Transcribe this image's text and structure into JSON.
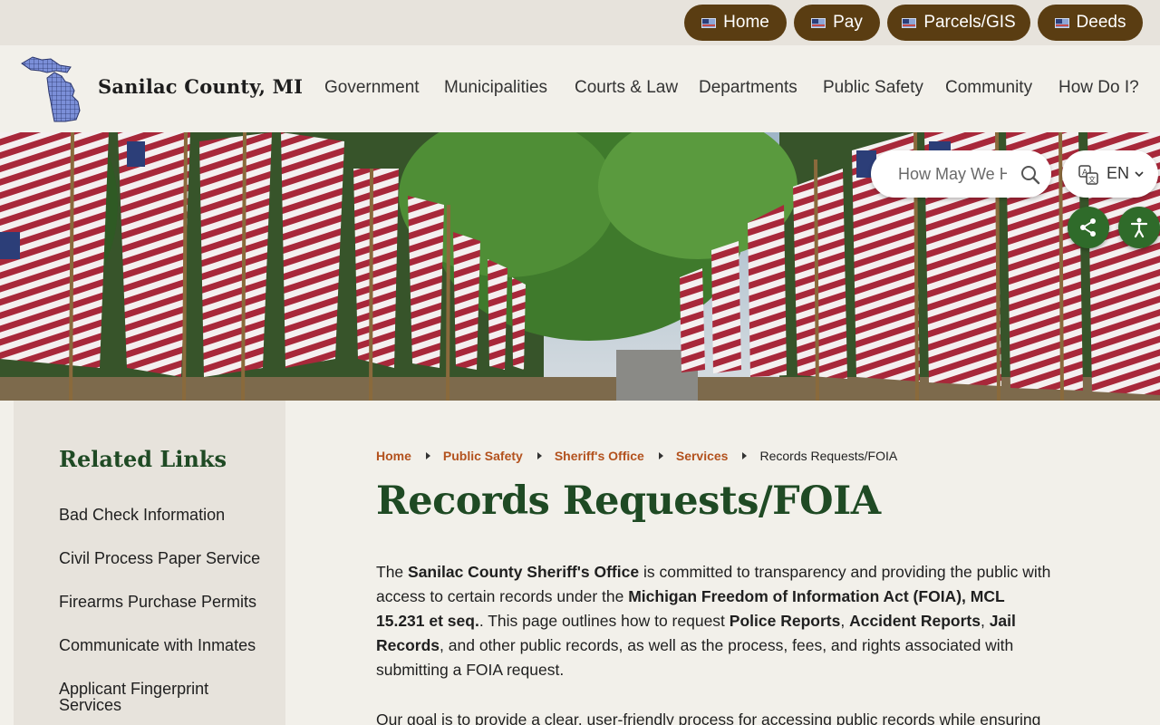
{
  "utility_nav": [
    {
      "label": "Home"
    },
    {
      "label": "Pay"
    },
    {
      "label": "Parcels/GIS"
    },
    {
      "label": "Deeds"
    }
  ],
  "site": {
    "name": "Sanilac County, MI"
  },
  "main_nav": [
    {
      "label": "Government"
    },
    {
      "label": "Municipalities"
    },
    {
      "label": "Courts & Law"
    },
    {
      "label": "Departments"
    },
    {
      "label": "Public Safety"
    },
    {
      "label": "Community"
    },
    {
      "label": "How Do I?"
    }
  ],
  "search": {
    "placeholder": "How May We Help You?"
  },
  "language": {
    "code": "EN"
  },
  "sidebar": {
    "title": "Related Links",
    "links": [
      {
        "label": "Bad Check Information"
      },
      {
        "label": "Civil Process Paper Service"
      },
      {
        "label": "Firearms Purchase Permits"
      },
      {
        "label": "Communicate with Inmates"
      },
      {
        "label": "Applicant Fingerprint Services"
      }
    ]
  },
  "breadcrumb": {
    "items": [
      {
        "label": "Home"
      },
      {
        "label": "Public Safety"
      },
      {
        "label": "Sheriff's Office"
      },
      {
        "label": "Services"
      }
    ],
    "current": "Records Requests/FOIA"
  },
  "page": {
    "title": "Records Requests/FOIA",
    "intro": {
      "t1": "The ",
      "b1": "Sanilac County Sheriff's Office",
      "t2": " is committed to transparency and providing the public with access to certain records under the ",
      "b2": "Michigan Freedom of Information Act (FOIA), MCL 15.231 et seq.",
      "t3": ". This page outlines how to request ",
      "b3": "Police Reports",
      "t4": ", ",
      "b4": "Accident Reports",
      "t5": ", ",
      "b5": "Jail Records",
      "t6": ", and other public records, as well as the process, fees, and rights associated with submitting a FOIA request."
    },
    "para2": "Our goal is to provide a clear, user-friendly process for accessing public records while ensuring"
  },
  "colors": {
    "pill_bg": "#5a3d12",
    "heading_green": "#1f4a24",
    "link_orange": "#b3521e",
    "fab_green": "#2f6b2a"
  }
}
